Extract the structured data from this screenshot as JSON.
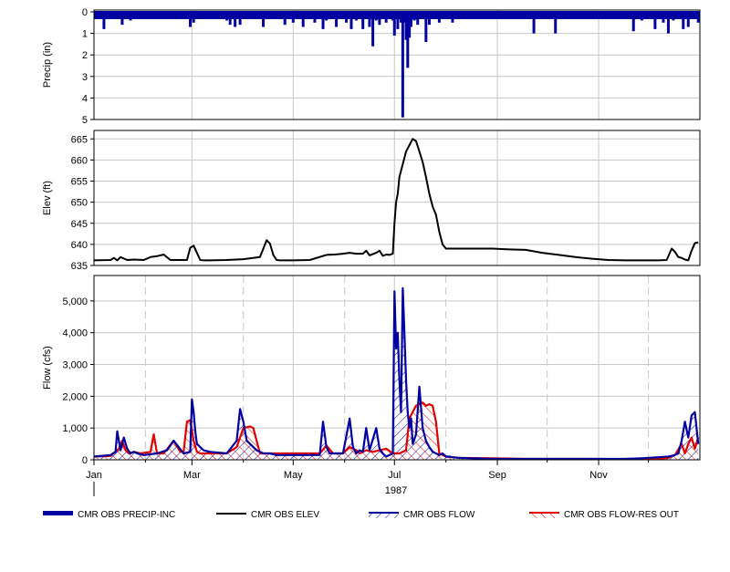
{
  "chart_data": [
    {
      "type": "bar",
      "ylabel": "Precip (in)",
      "ylim": [
        0,
        5
      ],
      "y_inverted": true,
      "yticks": [
        "0",
        "1",
        "2",
        "3",
        "4",
        "5"
      ],
      "grid": true,
      "series": [
        {
          "name": "CMR OBS PRECIP-INC",
          "color": "#0000a0",
          "day": [
            4,
            6,
            9,
            12,
            13,
            17,
            19,
            22,
            24,
            27,
            30,
            33,
            36,
            38,
            39,
            41,
            45,
            48,
            51,
            54,
            57,
            58,
            60,
            63,
            67,
            72,
            75,
            78,
            80,
            82,
            85,
            88,
            90,
            93,
            97,
            100,
            102,
            105,
            106,
            108,
            110,
            112,
            115,
            118,
            120,
            123,
            126,
            129,
            131,
            133,
            135,
            138,
            140,
            143,
            146,
            149,
            152,
            155,
            158,
            160,
            162,
            163,
            166,
            168,
            170,
            172,
            174,
            176,
            178,
            180,
            181,
            182,
            183,
            184,
            185,
            186,
            187,
            188,
            189,
            190,
            191,
            193,
            195,
            197,
            200,
            202,
            205,
            208,
            210,
            213,
            216,
            220,
            223,
            226,
            229,
            232,
            235,
            240,
            244,
            248,
            252,
            256,
            260,
            265,
            270,
            273,
            278,
            284,
            290,
            295,
            300,
            305,
            310,
            315,
            320,
            325,
            330,
            335,
            338,
            340,
            343,
            346,
            349,
            352,
            355,
            358,
            361,
            364
          ],
          "values": [
            0.3,
            0.8,
            0.2,
            0.1,
            0.3,
            0.6,
            0.2,
            0.4,
            0.2,
            0.3,
            0.1,
            0.3,
            0.1,
            0.3,
            0.2,
            0.2,
            0.2,
            0.2,
            0.3,
            0.3,
            0.2,
            0.7,
            0.5,
            0.2,
            0.3,
            0.2,
            0.2,
            0.2,
            0.4,
            0.6,
            0.7,
            0.6,
            0.3,
            0.2,
            0.2,
            0.3,
            0.7,
            0.3,
            0.2,
            0.3,
            0.3,
            0.3,
            0.6,
            0.3,
            0.5,
            0.3,
            0.7,
            0.3,
            0.2,
            0.5,
            0.3,
            0.8,
            0.4,
            0.3,
            0.7,
            0.3,
            0.5,
            0.8,
            0.4,
            0.2,
            0.8,
            0.3,
            0.7,
            1.6,
            0.4,
            0.6,
            0.3,
            0.5,
            0.3,
            0.4,
            1.1,
            0.3,
            0.8,
            0.2,
            0.5,
            4.9,
            0.5,
            1.3,
            2.6,
            1.2,
            0.7,
            0.4,
            0.6,
            0.3,
            1.4,
            0.6,
            0.3,
            0.5,
            0.3,
            0.2,
            0.5,
            0.3,
            0.3,
            0.3,
            0.2,
            0.3,
            0.2,
            0.2,
            0.2,
            0.2,
            0.2,
            0.2,
            0.2,
            1.0,
            0.3,
            0.2,
            1.0,
            0.3,
            0.2,
            0.2,
            0.2,
            0.2,
            0.2,
            0.2,
            0.2,
            0.9,
            0.4,
            0.2,
            0.8,
            0.3,
            0.5,
            1.0,
            0.4,
            0.2,
            0.8,
            0.7,
            0.2,
            0.5,
            0.2
          ]
        }
      ]
    },
    {
      "type": "line",
      "ylabel": "Elev (ft)",
      "ylim": [
        635,
        667
      ],
      "yticks": [
        "635",
        "640",
        "645",
        "650",
        "655",
        "660",
        "665"
      ],
      "grid": true,
      "series": [
        {
          "name": "CMR OBS ELEV",
          "color": "#000000",
          "day": [
            0,
            10,
            12,
            14,
            16,
            20,
            24,
            30,
            34,
            38,
            42,
            46,
            52,
            56,
            58,
            60,
            62,
            64,
            66,
            70,
            80,
            90,
            100,
            102,
            104,
            106,
            108,
            110,
            112,
            120,
            130,
            140,
            145,
            150,
            154,
            158,
            162,
            164,
            166,
            170,
            172,
            174,
            176,
            178,
            180,
            181,
            182,
            183,
            184,
            186,
            188,
            190,
            192,
            194,
            196,
            198,
            200,
            202,
            204,
            206,
            208,
            210,
            212,
            214,
            216,
            218,
            220,
            230,
            240,
            250,
            260,
            270,
            280,
            290,
            300,
            310,
            320,
            330,
            340,
            345,
            348,
            350,
            352,
            354,
            356,
            358,
            360,
            362,
            364
          ],
          "values": [
            636.2,
            636.3,
            636.8,
            636.2,
            637.0,
            636.3,
            636.4,
            636.3,
            637.0,
            637.2,
            637.6,
            636.3,
            636.3,
            636.3,
            639.2,
            639.7,
            638.0,
            636.3,
            636.2,
            636.2,
            636.3,
            636.5,
            637.0,
            639.0,
            641.0,
            640.2,
            637.5,
            636.3,
            636.2,
            636.2,
            636.3,
            637.5,
            637.6,
            637.8,
            638.0,
            637.8,
            637.8,
            638.5,
            637.4,
            638.0,
            638.5,
            637.3,
            637.6,
            637.5,
            637.8,
            645.0,
            650.0,
            652.0,
            656.0,
            659.0,
            662.0,
            663.5,
            665.0,
            664.5,
            662.0,
            659.5,
            656.0,
            652.0,
            649.0,
            647.0,
            643.0,
            640.0,
            639.0,
            639.0,
            639.0,
            639.0,
            639.0,
            639.0,
            639.0,
            638.8,
            638.7,
            638.0,
            637.5,
            637.0,
            636.6,
            636.3,
            636.2,
            636.2,
            636.2,
            636.3,
            639.0,
            638.2,
            637.0,
            636.8,
            636.4,
            636.2,
            638.5,
            640.3,
            640.5
          ]
        }
      ]
    },
    {
      "type": "area",
      "ylabel": "Flow (cfs)",
      "xlabel": "1987",
      "ylim": [
        0,
        5800
      ],
      "yticks": [
        "0",
        "1,000",
        "2,000",
        "3,000",
        "4,000",
        "5,000"
      ],
      "xticks": [
        "Jan",
        "Mar",
        "May",
        "Jul",
        "Sep",
        "Nov"
      ],
      "grid": true,
      "series": [
        {
          "name": "CMR OBS FLOW",
          "color": "#0000a0",
          "day": [
            0,
            10,
            13,
            14,
            16,
            18,
            20,
            22,
            24,
            26,
            30,
            38,
            44,
            48,
            54,
            58,
            59,
            60,
            61,
            62,
            64,
            66,
            70,
            80,
            86,
            88,
            90,
            92,
            94,
            96,
            98,
            100,
            102,
            104,
            106,
            110,
            120,
            136,
            138,
            140,
            142,
            144,
            150,
            154,
            156,
            158,
            160,
            162,
            164,
            166,
            170,
            172,
            174,
            176,
            180,
            181,
            182,
            183,
            184,
            185,
            186,
            187,
            188,
            189,
            190,
            191,
            192,
            194,
            196,
            198,
            200,
            202,
            204,
            206,
            208,
            210,
            212,
            214,
            216,
            220,
            240,
            260,
            280,
            300,
            320,
            330,
            340,
            346,
            350,
            352,
            354,
            356,
            358,
            360,
            362,
            364
          ],
          "values": [
            100,
            150,
            250,
            900,
            300,
            700,
            350,
            200,
            250,
            200,
            150,
            200,
            300,
            600,
            200,
            250,
            1900,
            1500,
            900,
            500,
            400,
            300,
            250,
            200,
            600,
            1600,
            1200,
            600,
            500,
            400,
            300,
            250,
            200,
            200,
            200,
            150,
            150,
            150,
            1200,
            400,
            200,
            200,
            200,
            1300,
            400,
            200,
            300,
            250,
            1000,
            300,
            1000,
            350,
            200,
            100,
            200,
            5300,
            3500,
            4000,
            2500,
            1500,
            5400,
            4000,
            2500,
            1500,
            1000,
            1300,
            500,
            800,
            2300,
            1000,
            600,
            400,
            250,
            200,
            150,
            200,
            100,
            100,
            80,
            60,
            30,
            30,
            30,
            30,
            30,
            50,
            80,
            100,
            150,
            200,
            600,
            1200,
            700,
            1400,
            1500,
            500
          ]
        },
        {
          "name": "CMR OBS FLOW-RES OUT",
          "color": "#e00000",
          "day": [
            0,
            10,
            15,
            17,
            19,
            21,
            24,
            28,
            34,
            36,
            38,
            42,
            48,
            52,
            54,
            56,
            58,
            60,
            62,
            64,
            66,
            70,
            80,
            86,
            90,
            94,
            96,
            100,
            104,
            108,
            118,
            136,
            140,
            144,
            150,
            154,
            158,
            160,
            164,
            168,
            172,
            176,
            180,
            184,
            188,
            190,
            194,
            198,
            200,
            202,
            204,
            206,
            208,
            212,
            216,
            220,
            240,
            260,
            280,
            300,
            320,
            340,
            346,
            350,
            354,
            356,
            358,
            360,
            362,
            364
          ],
          "values": [
            100,
            120,
            350,
            600,
            300,
            200,
            250,
            200,
            250,
            800,
            200,
            200,
            600,
            250,
            250,
            1200,
            1250,
            600,
            250,
            200,
            200,
            200,
            200,
            400,
            1000,
            1050,
            1000,
            200,
            200,
            200,
            200,
            200,
            450,
            200,
            200,
            400,
            300,
            200,
            300,
            250,
            300,
            350,
            200,
            200,
            300,
            1300,
            1700,
            1800,
            1700,
            1750,
            1700,
            1200,
            200,
            100,
            80,
            60,
            50,
            30,
            30,
            30,
            20,
            30,
            60,
            150,
            500,
            200,
            500,
            700,
            350,
            700
          ]
        }
      ]
    }
  ],
  "legend": [
    {
      "label": "CMR OBS PRECIP-INC",
      "color": "#0000a0",
      "style": "thick-bar"
    },
    {
      "label": "CMR OBS ELEV",
      "color": "#000000",
      "style": "line"
    },
    {
      "label": "CMR OBS FLOW",
      "color": "#0000a0",
      "style": "hatched"
    },
    {
      "label": "CMR OBS FLOW-RES OUT",
      "color": "#e00000",
      "style": "hatched"
    }
  ]
}
